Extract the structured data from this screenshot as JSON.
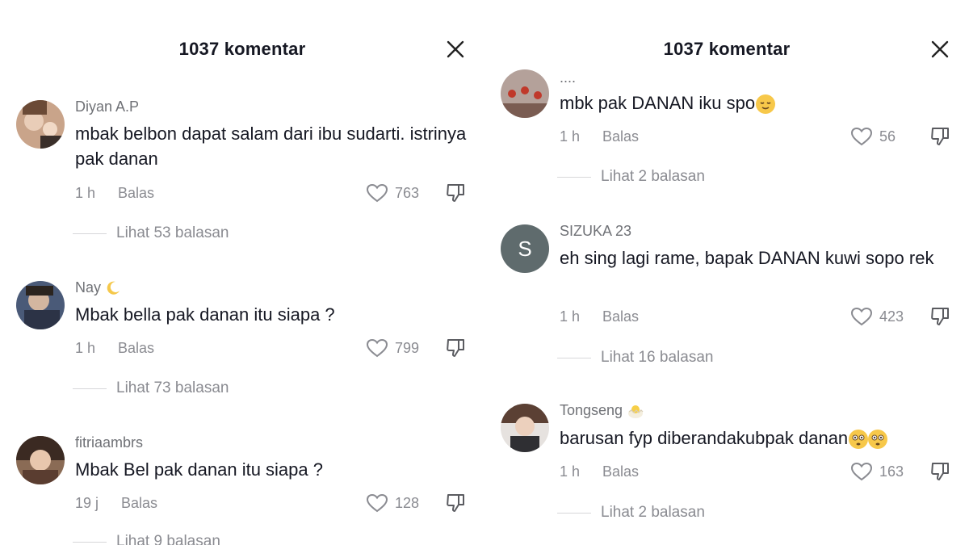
{
  "left": {
    "title": "1037 komentar",
    "comments": [
      {
        "user": "Diyan A.P",
        "text": "mbak belbon dapat salam dari ibu sudarti. istrinya pak danan",
        "time": "1 h",
        "reply": "Balas",
        "likes": "763",
        "thread": "Lihat 53 balasan"
      },
      {
        "user": "Nay",
        "user_emoji": "crescent-moon",
        "text": "Mbak bella pak danan itu siapa ?",
        "time": "1 h",
        "reply": "Balas",
        "likes": "799",
        "thread": "Lihat 73 balasan"
      },
      {
        "user": "fitriaambrs",
        "text": "Mbak Bel pak danan itu siapa ?",
        "time": "19 j",
        "reply": "Balas",
        "likes": "128",
        "thread": "Lihat 9 balasan"
      }
    ]
  },
  "right": {
    "title": "1037 komentar",
    "comments": [
      {
        "user": "....",
        "text": "mbk pak DANAN iku spo",
        "text_emoji": "relieved-face",
        "time": "1 h",
        "reply": "Balas",
        "likes": "56",
        "thread": "Lihat 2 balasan"
      },
      {
        "user": "SIZUKA 23",
        "avatar_letter": "S",
        "text": "eh sing lagi rame, bapak DANAN kuwi sopo rek",
        "time": "1 h",
        "reply": "Balas",
        "likes": "423",
        "thread": "Lihat 16 balasan"
      },
      {
        "user": "Tongseng",
        "user_emoji": "hatching-chick",
        "text": "barusan fyp diberandakubpak danan",
        "text_emoji": "flushed-face",
        "time": "1 h",
        "reply": "Balas",
        "likes": "163",
        "thread": "Lihat 2 balasan"
      }
    ]
  },
  "colors": {
    "text": "#161823",
    "muted": "#8a8b91",
    "avatar_gray": "#5f6b6d"
  }
}
